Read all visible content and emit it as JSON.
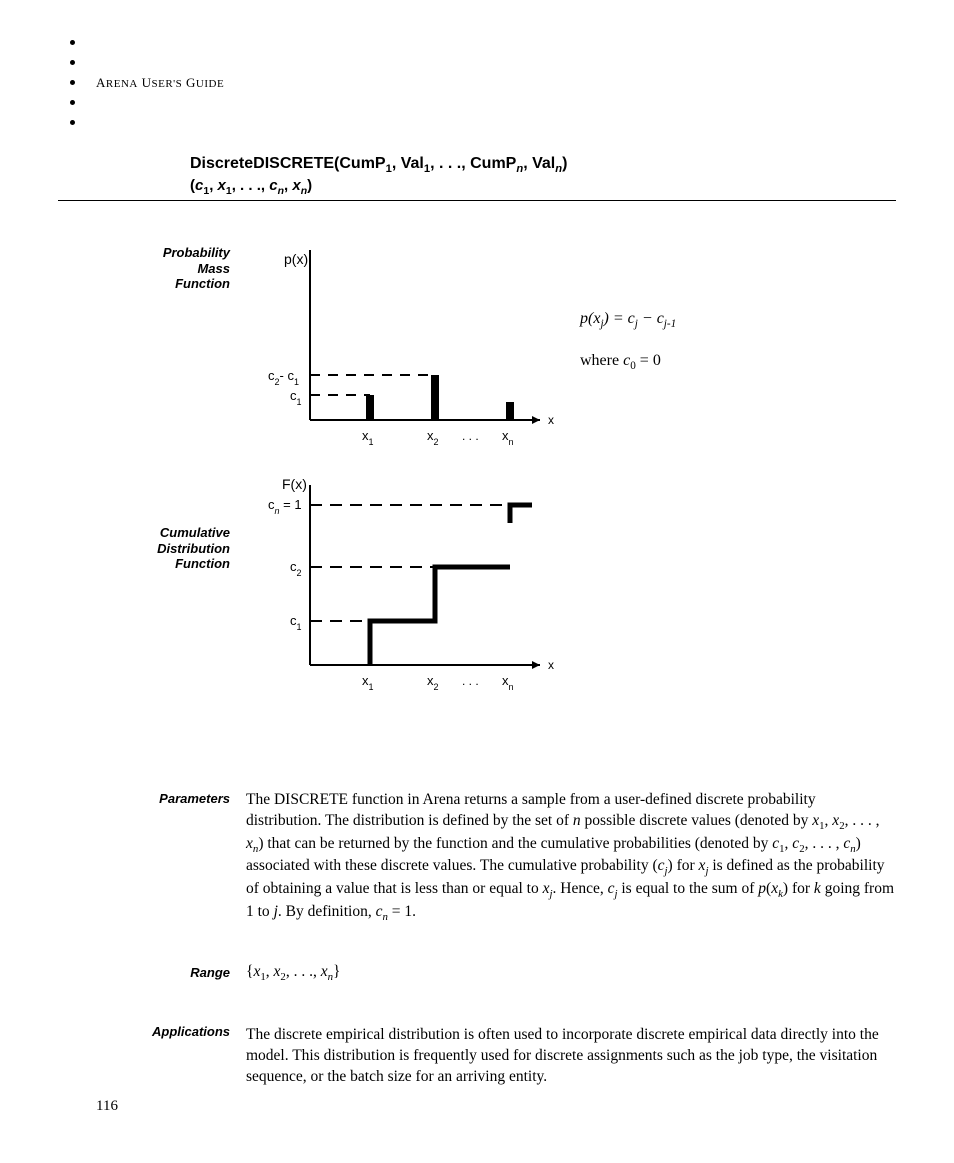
{
  "header": {
    "guide": "Arena User's Guide"
  },
  "title": {
    "line1_html": "DiscreteDISCRETE(CumP<sub>1</sub>, Val<sub>1</sub>, . . ., CumP<sub><i>n</i></sub>, Val<sub><i>n</i></sub>)",
    "line2_html": "(<i>c</i><sub>1</sub>, <i>x</i><sub>1</sub>, . . ., <i>c</i><sub><i>n</i></sub>, <i>x</i><sub><i>n</i></sub>)"
  },
  "labels": {
    "pmf": "Probability\nMass\nFunction",
    "cdf": "Cumulative\nDistribution\nFunction",
    "parameters": "Parameters",
    "range": "Range",
    "applications": "Applications"
  },
  "formula": {
    "main_html": "<i>p</i>(<i>x<sub>j</sub></i>) = <i>c<sub>j</sub></i> − <i>c</i><sub><i>j</i>-1</sub>",
    "where_html": "where <i>c</i><sub>0</sub> = 0"
  },
  "body": {
    "parameters_html": "The DISCRETE function in Arena returns a sample from a user-defined discrete probability distribution. The distribution is defined by the set of <i>n</i> possible discrete values (denoted by <i>x</i><sub>1</sub>, <i>x</i><sub>2</sub>, .&nbsp;.&nbsp;. , <i>x</i><sub><i>n</i></sub>) that can be returned by the function and the cumulative probabilities (denoted by <i>c</i><sub>1</sub>, <i>c</i><sub>2</sub>, .&nbsp;.&nbsp;. , <i>c</i><sub><i>n</i></sub>) associated with these discrete values. The cumulative probability (<i>c</i><sub><i>j</i></sub>) for <i>x</i><sub><i>j</i></sub> is defined as the probability of obtaining a value that is less than or equal to <i>x</i><sub><i>j</i></sub>. Hence, <i>c</i><sub><i>j</i></sub> is equal to the sum of <i>p</i>(<i>x</i><sub><i>k</i></sub>) for <i>k</i> going from 1 to <i>j</i>. By definition, <i>c</i><sub><i>n</i></sub>&nbsp;=&nbsp;1.",
    "range_html": "{<i>x</i><sub>1</sub>, <i>x</i><sub>2</sub>, .&nbsp;.&nbsp;., <i>x</i><sub><i>n</i></sub>}",
    "applications_html": "The discrete empirical distribution is often used to incorporate discrete empirical data directly into the model. This distribution is frequently used for discrete assignments such as the job type, the visitation sequence, or the batch size for an arriving entity."
  },
  "page_number": "116",
  "chart_data": [
    {
      "type": "bar",
      "title": "Probability Mass Function",
      "xlabel": "x",
      "ylabel": "p(x)",
      "x_ticks": [
        "x_1",
        "x_2",
        "...",
        "x_n"
      ],
      "y_ticks": [
        "c_1",
        "c_2 - c_1"
      ],
      "bars": [
        {
          "x": "x_1",
          "height_label": "c_1",
          "height_rel": 0.25
        },
        {
          "x": "x_2",
          "height_label": "c_2 - c_1",
          "height_rel": 0.45
        },
        {
          "x": "x_n",
          "height_label": "",
          "height_rel": 0.18
        }
      ],
      "formula": "p(x_j) = c_j - c_{j-1}, where c_0 = 0"
    },
    {
      "type": "line",
      "title": "Cumulative Distribution Function",
      "xlabel": "x",
      "ylabel": "F(x)",
      "x_ticks": [
        "x_1",
        "x_2",
        "...",
        "x_n"
      ],
      "y_ticks": [
        "c_1",
        "c_2",
        "c_n = 1"
      ],
      "step_points": [
        {
          "x": "x_1",
          "y_label": "c_1",
          "y_rel": 0.25
        },
        {
          "x": "x_2",
          "y_label": "c_2",
          "y_rel": 0.58
        },
        {
          "x": "x_n",
          "y_label": "c_n = 1",
          "y_rel": 1.0
        }
      ]
    }
  ]
}
